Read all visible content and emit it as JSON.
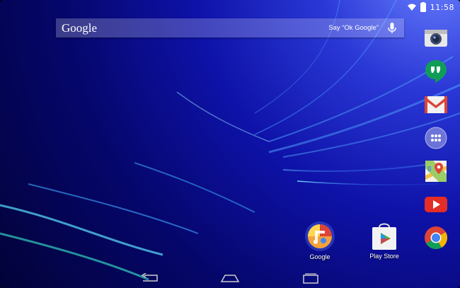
{
  "status_bar": {
    "time": "11:58"
  },
  "search": {
    "logo": "Google",
    "hint": "Say “Ok Google”"
  },
  "dock": {
    "items": [
      {
        "name": "Camera"
      },
      {
        "name": "Hangouts"
      },
      {
        "name": "Gmail"
      },
      {
        "name": "Apps"
      },
      {
        "name": "Maps"
      },
      {
        "name": "YouTube"
      },
      {
        "name": "Chrome"
      }
    ]
  },
  "home_apps": [
    {
      "label": "Google"
    },
    {
      "label": "Play Store"
    }
  ],
  "colors": {
    "hangouts": "#0f9d58",
    "gmail_red": "#db4437",
    "youtube_red": "#e52d27",
    "chrome_blue": "#4285f4"
  }
}
